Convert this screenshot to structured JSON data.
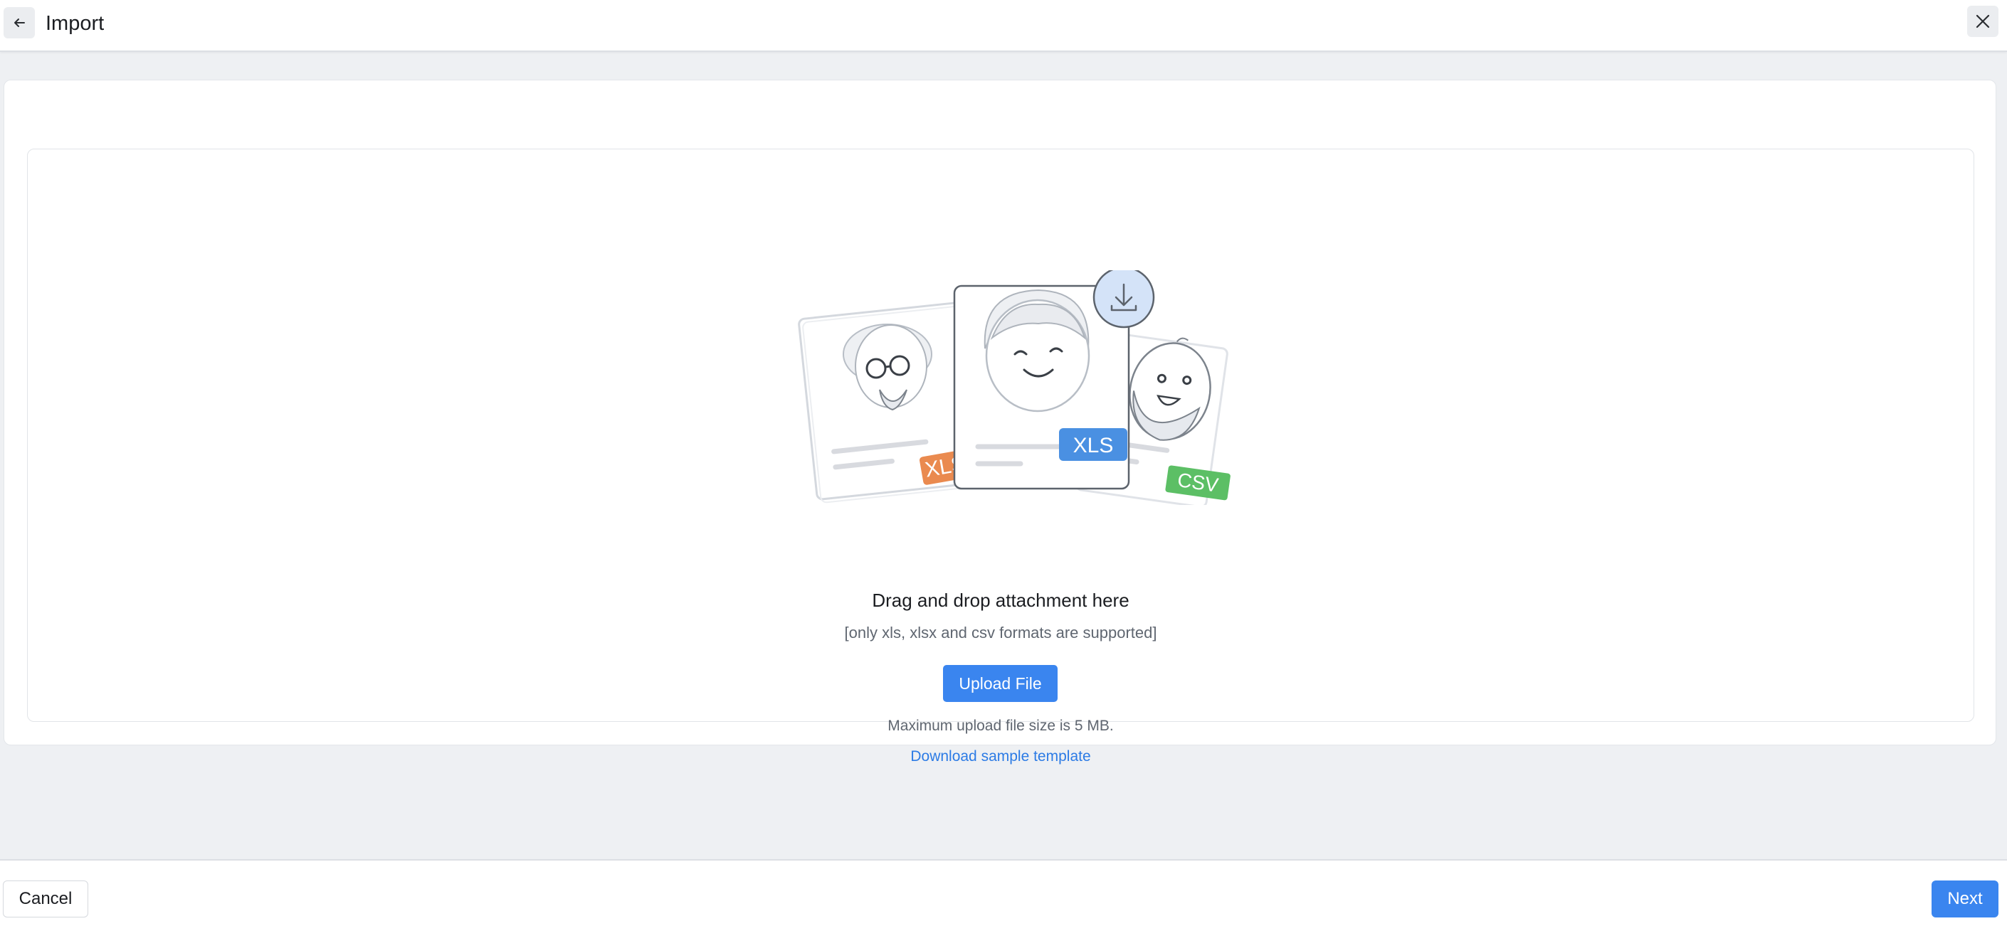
{
  "header": {
    "title": "Import",
    "back_icon": "arrow-left-icon",
    "close_icon": "close-icon"
  },
  "dropzone": {
    "badges": {
      "xlsx": "XLSX",
      "xls": "XLS",
      "csv": "CSV"
    },
    "drag_text": "Drag and drop attachment here",
    "formats_text": "[only xls, xlsx and csv formats are supported]",
    "upload_label": "Upload File",
    "max_size_text": "Maximum upload file size is 5 MB.",
    "download_link": "Download sample template"
  },
  "footer": {
    "cancel_label": "Cancel",
    "next_label": "Next"
  },
  "colors": {
    "primary": "#3a85ef",
    "link": "#2c7be5",
    "xlsx_badge": "#ea8a4f",
    "xls_badge": "#4a90e2",
    "csv_badge": "#5cbf65"
  }
}
